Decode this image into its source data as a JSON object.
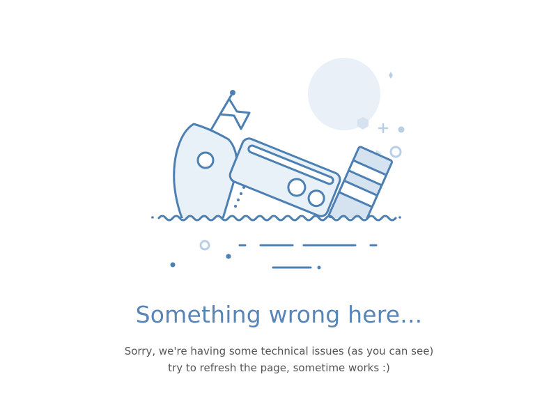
{
  "illustration": {
    "icon": "sinking-ship-icon",
    "colors": {
      "stroke": "#4c7fb2",
      "light_fill": "#e8f0f8",
      "mid_fill": "#d5e3f1",
      "sun": "#e9f0f8",
      "accent": "#b8cfe6"
    }
  },
  "error": {
    "title": "Something wrong here...",
    "message_line1": "Sorry, we're having some technical issues (as you can see)",
    "message_line2": "try to refresh the page, sometime works :)",
    "title_color": "#5785b7",
    "text_color": "#555555"
  }
}
